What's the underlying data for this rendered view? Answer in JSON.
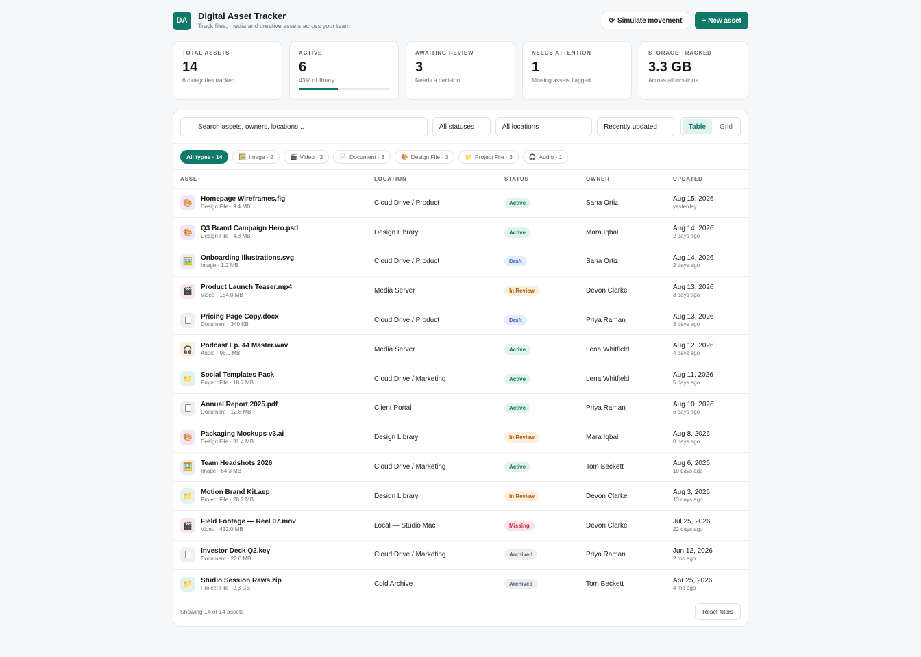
{
  "app": {
    "logo": "DA",
    "title": "Digital Asset Tracker",
    "subtitle": "Track files, media and creative assets across your team",
    "simulate_label": "Simulate movement",
    "new_asset_label": "+ New asset"
  },
  "stats": [
    {
      "label": "Total assets",
      "value": "14",
      "sub": "6 categories tracked"
    },
    {
      "label": "Active",
      "value": "6",
      "sub": "43% of library",
      "progress": 0.43
    },
    {
      "label": "Awaiting review",
      "value": "3",
      "sub": "Needs a decision"
    },
    {
      "label": "Needs attention",
      "value": "1",
      "sub": "Missing assets flagged"
    },
    {
      "label": "Storage tracked",
      "value": "3.3 GB",
      "sub": "Across all locations"
    }
  ],
  "toolbar": {
    "search_placeholder": "Search assets, owners, locations...",
    "status_filter": "All statuses",
    "location_filter": "All locations",
    "sort": "Recently updated",
    "view_table": "Table",
    "view_grid": "Grid"
  },
  "chips": [
    {
      "label": "All types · 14",
      "icon": ""
    },
    {
      "label": "Image · 2",
      "icon": "🖼️"
    },
    {
      "label": "Video · 2",
      "icon": "🎬"
    },
    {
      "label": "Document · 3",
      "icon": "📄"
    },
    {
      "label": "Design File · 3",
      "icon": "🎨"
    },
    {
      "label": "Project File · 3",
      "icon": "📁"
    },
    {
      "label": "Audio · 1",
      "icon": "🎧"
    }
  ],
  "columns": [
    "Asset",
    "Location",
    "Status",
    "Owner",
    "Updated"
  ],
  "rows": [
    {
      "name": "Homepage Wireframes.fig",
      "meta": "Design File · 9.4 MB",
      "type": "design",
      "icon": "palette-icon",
      "location": "Cloud Drive / Product",
      "status": "Active",
      "status_class": "active",
      "owner": "Sana Ortiz",
      "date": "Aug 15, 2026",
      "rel": "yesterday"
    },
    {
      "name": "Q3 Brand Campaign Hero.psd",
      "meta": "Design File · 4.8 MB",
      "type": "design",
      "icon": "palette-icon",
      "location": "Design Library",
      "status": "Active",
      "status_class": "active",
      "owner": "Mara Iqbal",
      "date": "Aug 14, 2026",
      "rel": "2 days ago"
    },
    {
      "name": "Onboarding Illustrations.svg",
      "meta": "Image · 1.2 MB",
      "type": "image",
      "icon": "image-icon",
      "location": "Cloud Drive / Product",
      "status": "Draft",
      "status_class": "draft",
      "owner": "Sana Ortiz",
      "date": "Aug 14, 2026",
      "rel": "2 days ago"
    },
    {
      "name": "Product Launch Teaser.mp4",
      "meta": "Video · 184.0 MB",
      "type": "video",
      "icon": "clapper-icon",
      "location": "Media Server",
      "status": "In Review",
      "status_class": "review",
      "owner": "Devon Clarke",
      "date": "Aug 13, 2026",
      "rel": "3 days ago"
    },
    {
      "name": "Pricing Page Copy.docx",
      "meta": "Document · 340 KB",
      "type": "document",
      "icon": "document-icon",
      "location": "Cloud Drive / Product",
      "status": "Draft",
      "status_class": "draft",
      "owner": "Priya Raman",
      "date": "Aug 13, 2026",
      "rel": "3 days ago"
    },
    {
      "name": "Podcast Ep. 44 Master.wav",
      "meta": "Audio · 96.0 MB",
      "type": "audio",
      "icon": "headphones-icon",
      "location": "Media Server",
      "status": "Active",
      "status_class": "active",
      "owner": "Lena Whitfield",
      "date": "Aug 12, 2026",
      "rel": "4 days ago"
    },
    {
      "name": "Social Templates Pack",
      "meta": "Project File · 18.7 MB",
      "type": "project",
      "icon": "folder-icon",
      "location": "Cloud Drive / Marketing",
      "status": "Active",
      "status_class": "active",
      "owner": "Lena Whitfield",
      "date": "Aug 11, 2026",
      "rel": "5 days ago"
    },
    {
      "name": "Annual Report 2025.pdf",
      "meta": "Document · 12.8 MB",
      "type": "document",
      "icon": "document-icon",
      "location": "Client Portal",
      "status": "Active",
      "status_class": "active",
      "owner": "Priya Raman",
      "date": "Aug 10, 2026",
      "rel": "6 days ago"
    },
    {
      "name": "Packaging Mockups v3.ai",
      "meta": "Design File · 31.4 MB",
      "type": "design",
      "icon": "palette-icon",
      "location": "Design Library",
      "status": "In Review",
      "status_class": "review",
      "owner": "Mara Iqbal",
      "date": "Aug 8, 2026",
      "rel": "8 days ago"
    },
    {
      "name": "Team Headshots 2026",
      "meta": "Image · 64.3 MB",
      "type": "image",
      "icon": "image-icon",
      "location": "Cloud Drive / Marketing",
      "status": "Active",
      "status_class": "active",
      "owner": "Tom Beckett",
      "date": "Aug 6, 2026",
      "rel": "10 days ago"
    },
    {
      "name": "Motion Brand Kit.aep",
      "meta": "Project File · 78.2 MB",
      "type": "project",
      "icon": "folder-icon",
      "location": "Design Library",
      "status": "In Review",
      "status_class": "review",
      "owner": "Devon Clarke",
      "date": "Aug 3, 2026",
      "rel": "13 days ago"
    },
    {
      "name": "Field Footage — Reel 07.mov",
      "meta": "Video · 412.0 MB",
      "type": "video",
      "icon": "clapper-icon",
      "location": "Local — Studio Mac",
      "status": "Missing",
      "status_class": "missing",
      "owner": "Devon Clarke",
      "date": "Jul 25, 2026",
      "rel": "22 days ago"
    },
    {
      "name": "Investor Deck Q2.key",
      "meta": "Document · 22.6 MB",
      "type": "document",
      "icon": "document-icon",
      "location": "Cloud Drive / Marketing",
      "status": "Archived",
      "status_class": "archived",
      "owner": "Priya Raman",
      "date": "Jun 12, 2026",
      "rel": "2 mo ago"
    },
    {
      "name": "Studio Session Raws.zip",
      "meta": "Project File · 2.3 GB",
      "type": "project",
      "icon": "folder-icon",
      "location": "Cold Archive",
      "status": "Archived",
      "status_class": "archived",
      "owner": "Tom Beckett",
      "date": "Apr 25, 2026",
      "rel": "4 mo ago"
    }
  ],
  "footer": {
    "showing": "Showing 14 of 14 assets",
    "reset_label": "Reset filters"
  }
}
